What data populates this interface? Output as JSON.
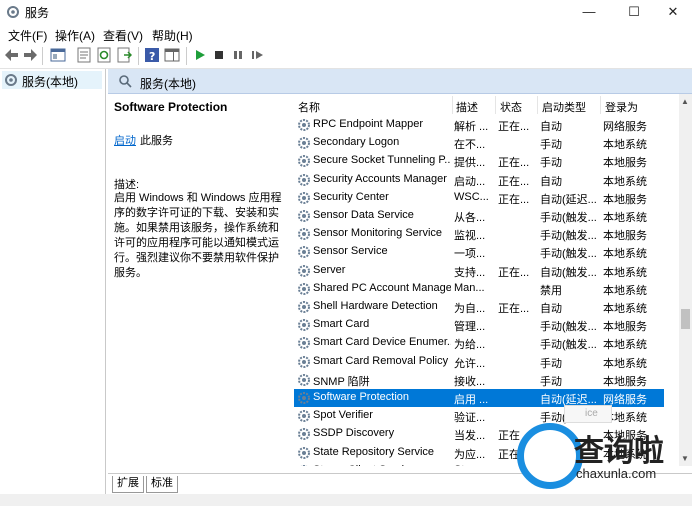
{
  "window": {
    "title": "服务",
    "minimize": "—",
    "maximize": "☐",
    "close": "✕"
  },
  "menu": [
    "文件(F)",
    "操作(A)",
    "查看(V)",
    "帮助(H)"
  ],
  "tree": {
    "root": "服务(本地)"
  },
  "pane": {
    "header": "服务(本地)"
  },
  "description": {
    "service_name": "Software Protection",
    "start_link": "启动",
    "start_suffix": "此服务",
    "desc_label": "描述:",
    "desc_text": "启用 Windows 和 Windows 应用程序的数字许可证的下载、安装和实施。如果禁用该服务，操作系统和许可的应用程序可能以通知模式运行。强烈建议你不要禁用软件保护服务。"
  },
  "columns": {
    "name": "名称",
    "desc": "描述",
    "status": "状态",
    "type": "启动类型",
    "logon": "登录为"
  },
  "services": [
    {
      "name": "RPC Endpoint Mapper",
      "desc": "解析 ...",
      "status": "正在...",
      "type": "自动",
      "logon": "网络服务"
    },
    {
      "name": "Secondary Logon",
      "desc": "在不...",
      "status": "",
      "type": "手动",
      "logon": "本地系统"
    },
    {
      "name": "Secure Socket Tunneling P...",
      "desc": "提供...",
      "status": "正在...",
      "type": "手动",
      "logon": "本地服务"
    },
    {
      "name": "Security Accounts Manager",
      "desc": "启动...",
      "status": "正在...",
      "type": "自动",
      "logon": "本地系统"
    },
    {
      "name": "Security Center",
      "desc": "WSC...",
      "status": "正在...",
      "type": "自动(延迟...",
      "logon": "本地服务"
    },
    {
      "name": "Sensor Data Service",
      "desc": "从各...",
      "status": "",
      "type": "手动(触发...",
      "logon": "本地系统"
    },
    {
      "name": "Sensor Monitoring Service",
      "desc": "监视...",
      "status": "",
      "type": "手动(触发...",
      "logon": "本地服务"
    },
    {
      "name": "Sensor Service",
      "desc": "一项...",
      "status": "",
      "type": "手动(触发...",
      "logon": "本地系统"
    },
    {
      "name": "Server",
      "desc": "支持...",
      "status": "正在...",
      "type": "自动(触发...",
      "logon": "本地系统"
    },
    {
      "name": "Shared PC Account Manager",
      "desc": "Man...",
      "status": "",
      "type": "禁用",
      "logon": "本地系统"
    },
    {
      "name": "Shell Hardware Detection",
      "desc": "为自...",
      "status": "正在...",
      "type": "自动",
      "logon": "本地系统"
    },
    {
      "name": "Smart Card",
      "desc": "管理...",
      "status": "",
      "type": "手动(触发...",
      "logon": "本地服务"
    },
    {
      "name": "Smart Card Device Enumer...",
      "desc": "为给...",
      "status": "",
      "type": "手动(触发...",
      "logon": "本地系统"
    },
    {
      "name": "Smart Card Removal Policy",
      "desc": "允许...",
      "status": "",
      "type": "手动",
      "logon": "本地系统"
    },
    {
      "name": "SNMP 陷阱",
      "desc": "接收...",
      "status": "",
      "type": "手动",
      "logon": "本地服务"
    },
    {
      "name": "Software Protection",
      "desc": "启用 ...",
      "status": "",
      "type": "自动(延迟...",
      "logon": "网络服务"
    },
    {
      "name": "Spot Verifier",
      "desc": "验证...",
      "status": "",
      "type": "手动(触发...",
      "logon": "本地系统"
    },
    {
      "name": "SSDP Discovery",
      "desc": "当发...",
      "status": "正在",
      "type": "手动",
      "logon": "本地服务"
    },
    {
      "name": "State Repository Service",
      "desc": "为应...",
      "status": "正在",
      "type": "",
      "logon": "本地系统"
    },
    {
      "name": "Steam Client Service",
      "desc": "Stea...",
      "status": "",
      "type": "",
      "logon": ""
    }
  ],
  "selected_index": 15,
  "tooltip_text": "ice",
  "tabs": [
    "扩展",
    "标准"
  ],
  "watermark": {
    "text": "查询啦",
    "url": "chaxunla.com"
  },
  "colors": {
    "selection": "#0078d7",
    "header_bg": "#d9e6f5",
    "link": "#0066cc"
  }
}
